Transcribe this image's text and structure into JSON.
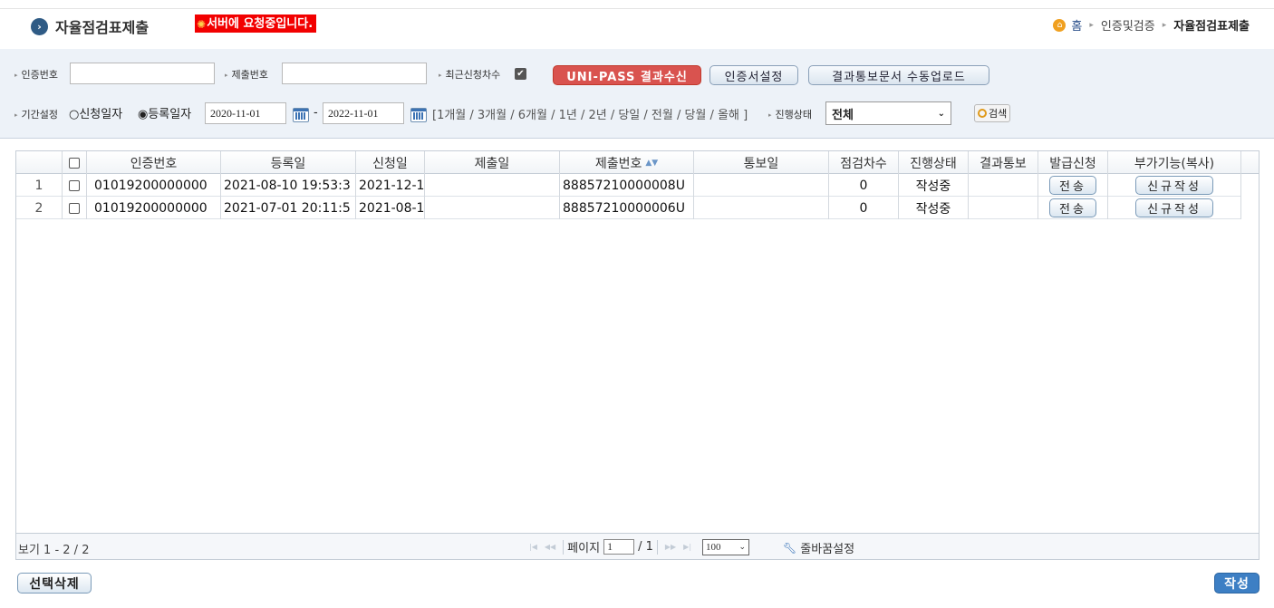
{
  "header": {
    "title": "자율점검표제출",
    "title_icon": "chevron-right-circle-icon",
    "server_message": "서버에 요청중입니다.",
    "breadcrumb": [
      "홈",
      "인증및검증",
      "자율점검표제출"
    ]
  },
  "search": {
    "cert_no_label": "인증번호",
    "cert_no_value": "",
    "submit_no_label": "제출번호",
    "submit_no_value": "",
    "recent_label": "최근신청차수",
    "recent_checked": true,
    "unipass_button": "UNI-PASS 결과수신",
    "cert_setting_button": "인증서설정",
    "upload_button": "결과통보문서 수동업로드",
    "period_label": "기간설정",
    "radio_apply": "○신청일자",
    "radio_register": "◉등록일자",
    "date_from": "2020-11-01",
    "date_sep": "-",
    "date_to": "2022-11-01",
    "period_links": "[1개월 / 3개월 / 6개월 / 1년 / 2년 / 당일 / 전월 / 당월 / 올해 ]",
    "status_label": "진행상태",
    "status_value": "전체",
    "search_button": "검색"
  },
  "grid": {
    "columns": [
      "",
      "",
      "인증번호",
      "등록일",
      "신청일",
      "제출일",
      "제출번호",
      "통보일",
      "점검차수",
      "진행상태",
      "결과통보",
      "발급신청",
      "부가기능(복사)"
    ],
    "rows": [
      {
        "num": "1",
        "cert_no": "01019200000000",
        "reg_date": "2021-08-10 19:53:3",
        "apply_date": "2021-12-1",
        "submit_date": "",
        "submit_no": "88857210000008U",
        "notice_date": "",
        "round": "0",
        "status": "작성중",
        "result": "",
        "send": "전송",
        "copy": "신규작성"
      },
      {
        "num": "2",
        "cert_no": "01019200000000",
        "reg_date": "2021-07-01 20:11:5",
        "apply_date": "2021-08-1",
        "submit_date": "",
        "submit_no": "88857210000006U",
        "notice_date": "",
        "round": "0",
        "status": "작성중",
        "result": "",
        "send": "전송",
        "copy": "신규작성"
      }
    ]
  },
  "pager": {
    "view_info": "보기 1 - 2 / 2",
    "page_label": "페이지",
    "page_value": "1",
    "page_total": "/ 1",
    "rows_per_page": "100",
    "wrap_setting": "줄바꿈설정"
  },
  "footer": {
    "delete_button": "선택삭제",
    "write_button": "작성"
  }
}
